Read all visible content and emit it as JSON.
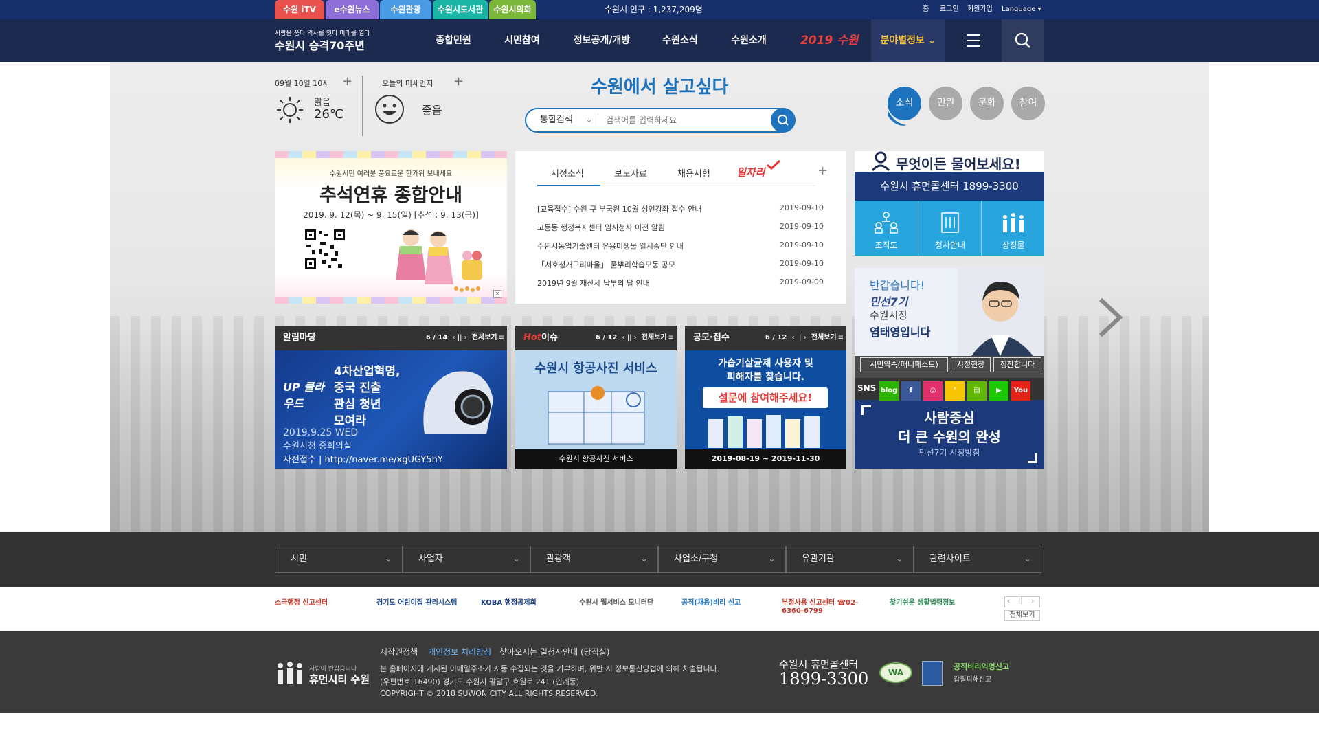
{
  "top_tabs": [
    {
      "label": "수원 iTV",
      "color": "#e8514d"
    },
    {
      "label": "e수원뉴스",
      "color": "#8e6ed9"
    },
    {
      "label": "수원관광",
      "color": "#4a9be6"
    },
    {
      "label": "수원시도서관",
      "color": "#1bb5a6"
    },
    {
      "label": "수원시의회",
      "color": "#7bb83a"
    }
  ],
  "population": "수원시 인구 : 1,237,209명",
  "util": {
    "home": "홈",
    "login": "로그인",
    "join": "회원가입",
    "language": "Language"
  },
  "brand": {
    "tagline": "사람을 품다  역사를 잇다  미래를 열다",
    "title": "수원시 승격70주년"
  },
  "gnb": [
    "종합민원",
    "시민참여",
    "정보공개/개방",
    "수원소식",
    "수원소개"
  ],
  "logo2019": "2019 수원",
  "field_info": "분야별정보",
  "weather": {
    "date": "09월 10일 10시",
    "condition": "맑음",
    "temp": "26℃",
    "dust_label": "오늘의 미세먼지",
    "dust_value": "좋음"
  },
  "slogan": "수원에서 살고싶다",
  "search": {
    "category": "통합검색",
    "placeholder": "검색어를 입력하세요"
  },
  "circle_tabs": [
    {
      "label": "소식",
      "color": "#1e73be"
    },
    {
      "label": "민원",
      "color": "#a9a9a9"
    },
    {
      "label": "문화",
      "color": "#a9a9a9"
    },
    {
      "label": "참여",
      "color": "#a9a9a9"
    }
  ],
  "banner": {
    "subtitle": "수원시민 여러분 풍요로운 한가위 보내세요",
    "title": "추석연휴 종합안내",
    "dates": "2019. 9. 12(목) ~ 9. 15(일) [추석 : 9. 13(금)]"
  },
  "notice": {
    "tabs": [
      "시정소식",
      "보도자료",
      "채용시험",
      "일자리"
    ],
    "items": [
      {
        "title": "[교육접수] 수원 구 부국원 10월 성인강좌 접수 안내",
        "date": "2019-09-10"
      },
      {
        "title": "고등동 행정복지센터 임시청사 이전 알림",
        "date": "2019-09-10"
      },
      {
        "title": "수원시농업기술센터 유용미생물 일시중단 안내",
        "date": "2019-09-10"
      },
      {
        "title": "「서호청개구리마을」 풀뿌리학습모동 공모",
        "date": "2019-09-10"
      },
      {
        "title": "2019년 9월 재산세 납부의 달 안내",
        "date": "2019-09-09"
      }
    ]
  },
  "callcenter": {
    "headline": "무엇이든 물어보세요!",
    "name_number": "수원시 휴먼콜센터  1899-3300",
    "items": [
      "조직도",
      "청사안내",
      "상징물"
    ]
  },
  "cards": [
    {
      "title": "알림마당",
      "counter": "6 / 14",
      "more": "전체보기",
      "lines": [
        "4차산업혁명,",
        "중국 진출",
        "관심 청년",
        "모여라"
      ],
      "badge": "UP 클라우드",
      "footer": "2019.9.25 WED",
      "footer2": "수원시청 중회의실",
      "footer3": "사전접수 | http://naver.me/xgUGY5hY"
    },
    {
      "title_hot": "Hot",
      "title": "이슈",
      "counter": "6 / 12",
      "more": "전체보기",
      "headline": "수원시 항공사진 서비스",
      "caption": "수원시 항공사진 서비스"
    },
    {
      "title": "공모·접수",
      "counter": "6 / 12",
      "more": "전체보기",
      "lines": [
        "가습기살균제 사용자 및",
        "피해자를 찾습니다."
      ],
      "button": "설문에 참여해주세요!",
      "caption": "2019-08-19 ~ 2019-11-30"
    }
  ],
  "mayor": {
    "greeting": "반갑습니다!",
    "line2": "민선7기",
    "line3": "수원시장",
    "name_line": "염태영입니다",
    "links": [
      "시민약속(매니페스토)",
      "시정현장",
      "칭찬합니다"
    ],
    "sns_label": "SNS",
    "sns_icons": [
      {
        "label": "blog",
        "color": "#2db400"
      },
      {
        "label": "f",
        "color": "#3b5998"
      },
      {
        "label": "◎",
        "color": "#e1306c"
      },
      {
        "label": "❜",
        "color": "#f7c600"
      },
      {
        "label": "▤",
        "color": "#5fb700"
      },
      {
        "label": "▶",
        "color": "#1ec800"
      },
      {
        "label": "You Tube",
        "color": "#e62117"
      }
    ],
    "slogan1": "사람중심",
    "slogan2": "더 큰 수원의 완성",
    "slogan3": "민선7기 시정방침"
  },
  "footer_nav": [
    "시민",
    "사업자",
    "관광객",
    "사업소/구청",
    "유관기관",
    "관련사이트"
  ],
  "footer_logos": [
    {
      "label": "소극행정 신고센터",
      "color": "#c0392b"
    },
    {
      "label": "경기도 어린이집 관리시스템",
      "color": "#1a4a8a"
    },
    {
      "label": "KOBA 행정공제회",
      "color": "#1a3d7c"
    },
    {
      "label": "수원시 웹서비스 모니터단",
      "color": "#555555"
    },
    {
      "label": "공직(채용)비리 신고",
      "color": "#1e73be"
    },
    {
      "label": "부정사용 신고센터 ☎02-6360-6799",
      "color": "#c0392b"
    },
    {
      "label": "찾기쉬운 생활법령정보",
      "color": "#2e8b57"
    }
  ],
  "footer_more": "전체보기",
  "bottom": {
    "links": [
      "저작권정책",
      "개인정보 처리방침",
      "찾아오시는 길",
      "청사안내 (당직실)"
    ],
    "notice": "본 홈페이지에 게시된 이메일주소가 자동 수집되는 것을 거부하며, 위반 시 정보통신망법에 의해 처벌됩니다.",
    "address": "(우편번호:16490) 경기도 수원시 팔달구 효원로 241 (인계동)",
    "copyright": "COPYRIGHT © 2018 SUWON CITY ALL RIGHTS RESERVED.",
    "brand_small": "사람이 반갑습니다",
    "brand": "휴먼시티 수원",
    "callcenter": "수원시 휴먼콜센터",
    "phone": "1899-3300",
    "wa": "WA",
    "integrity": "공직비리익명신고",
    "integrity2": "갑질피해신고"
  }
}
